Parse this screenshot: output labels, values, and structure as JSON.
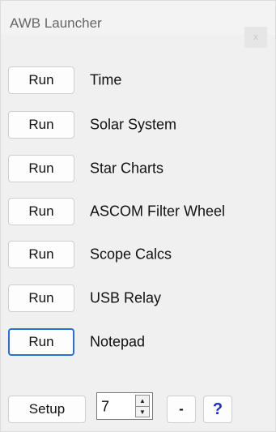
{
  "window": {
    "title": "AWB Launcher",
    "close_label": "x"
  },
  "apps": [
    {
      "button": "Run",
      "label": "Time"
    },
    {
      "button": "Run",
      "label": "Solar System"
    },
    {
      "button": "Run",
      "label": "Star Charts"
    },
    {
      "button": "Run",
      "label": "ASCOM Filter Wheel"
    },
    {
      "button": "Run",
      "label": "Scope Calcs"
    },
    {
      "button": "Run",
      "label": "USB Relay"
    },
    {
      "button": "Run",
      "label": "Notepad"
    }
  ],
  "footer": {
    "setup_label": "Setup",
    "count_value": "7",
    "spin_up": "▲",
    "spin_down": "▼",
    "minus_label": "-",
    "help_label": "?"
  }
}
